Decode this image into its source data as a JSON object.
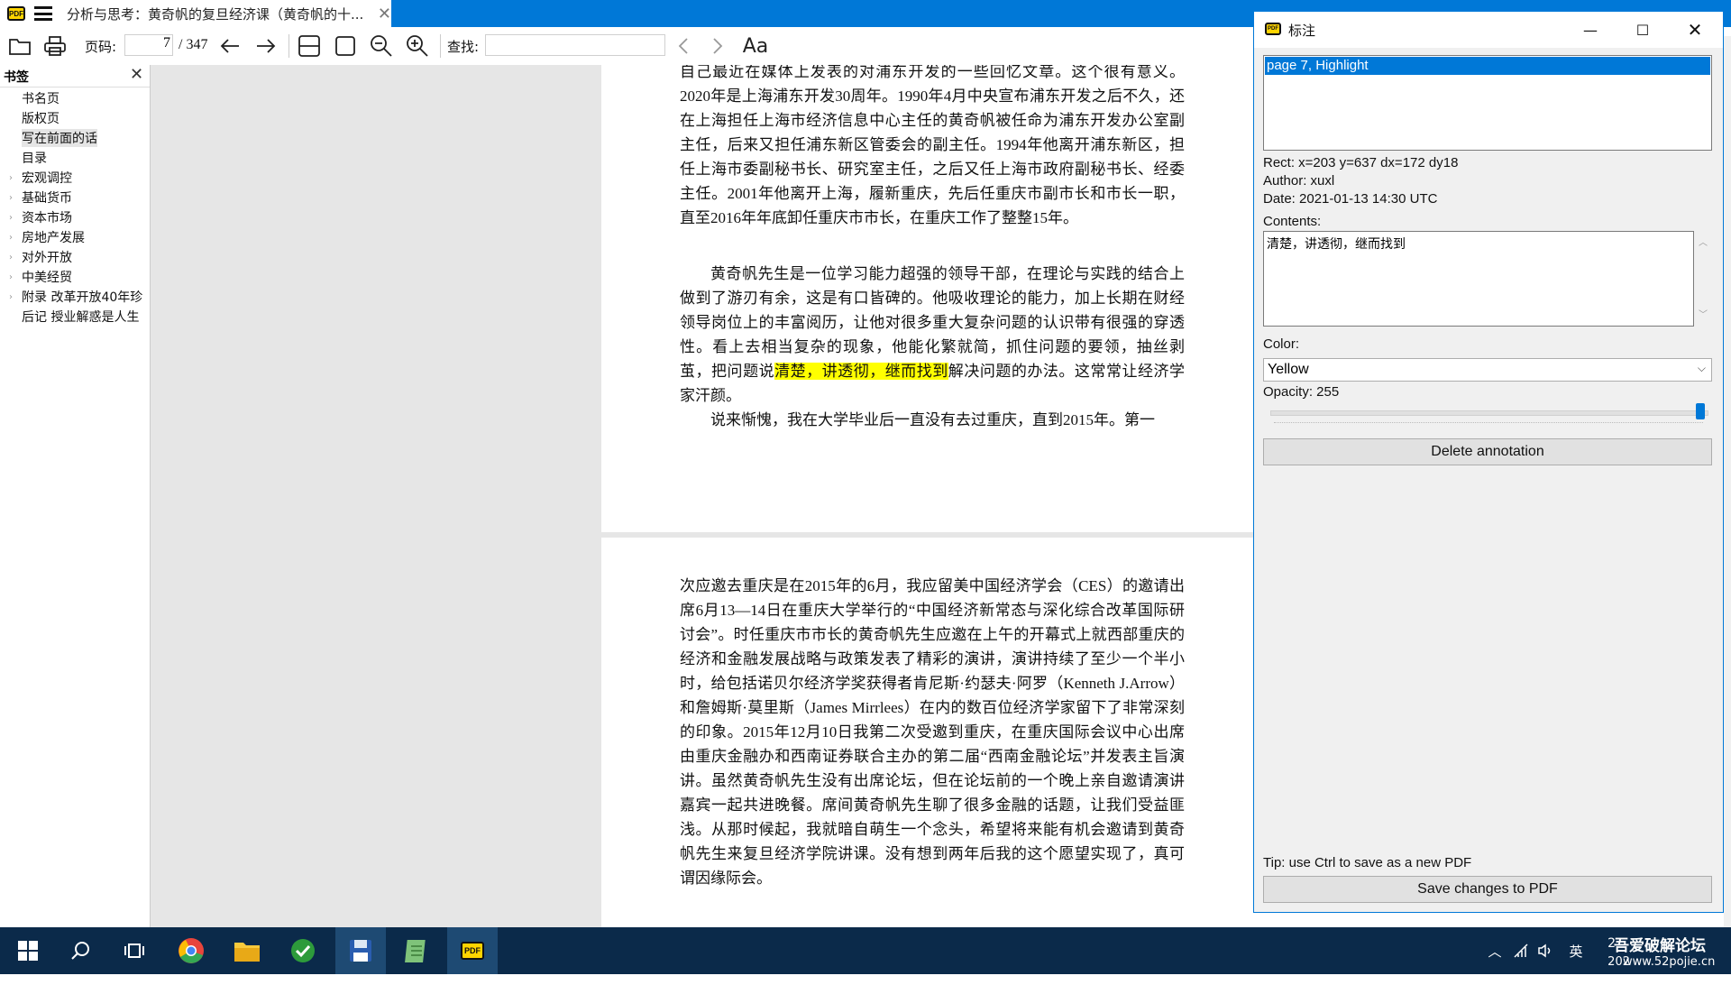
{
  "tab": {
    "title": "分析与思考：黄奇帆的复旦经济课（黄奇帆的十..."
  },
  "toolbar": {
    "page_label": "页码:",
    "page_current": "7",
    "page_total": "/ 347",
    "find_label": "查找:",
    "find_placeholder": "",
    "font_glyph": "Aa"
  },
  "sidebar": {
    "title": "书签",
    "items": [
      {
        "label": "书名页",
        "expandable": false,
        "selected": false
      },
      {
        "label": "版权页",
        "expandable": false,
        "selected": false
      },
      {
        "label": "写在前面的话",
        "expandable": false,
        "selected": true
      },
      {
        "label": "目录",
        "expandable": false,
        "selected": false
      },
      {
        "label": "宏观调控",
        "expandable": true,
        "selected": false
      },
      {
        "label": "基础货币",
        "expandable": true,
        "selected": false
      },
      {
        "label": "资本市场",
        "expandable": true,
        "selected": false
      },
      {
        "label": "房地产发展",
        "expandable": true,
        "selected": false
      },
      {
        "label": "对外开放",
        "expandable": true,
        "selected": false
      },
      {
        "label": "中美经贸",
        "expandable": true,
        "selected": false
      },
      {
        "label": "附录 改革开放40年珍",
        "expandable": true,
        "selected": false
      },
      {
        "label": "后记 授业解惑是人生",
        "expandable": false,
        "selected": false
      }
    ]
  },
  "document": {
    "page1": {
      "p1": "自己最近在媒体上发表的对浦东开发的一些回忆文章。这个很有意义。2020年是上海浦东开发30周年。1990年4月中央宣布浦东开发之后不久，还在上海担任上海市经济信息中心主任的黄奇帆被任命为浦东开发办公室副主任，后来又担任浦东新区管委会的副主任。1994年他离开浦东新区，担任上海市委副秘书长、研究室主任，之后又任上海市政府副秘书长、经委主任。2001年他离开上海，履新重庆，先后任重庆市副市长和市长一职，直至2016年年底卸任重庆市市长，在重庆工作了整整15年。",
      "p2_before": "黄奇帆先生是一位学习能力超强的领导干部，在理论与实践的结合上做到了游刃有余，这是有口皆碑的。他吸收理论的能力，加上长期在财经领导岗位上的丰富阅历，让他对很多重大复杂问题的认识带有很强的穿透性。看上去相当复杂的现象，他能化繁就简，抓住问题的要领，抽丝剥茧，把问题说",
      "p2_highlight": "清楚，讲透彻，继而找到",
      "p2_after": "解决问题的办法。这常常让经济学家汗颜。",
      "p3": "说来惭愧，我在大学毕业后一直没有去过重庆，直到2015年。第一"
    },
    "page2": {
      "p1": "次应邀去重庆是在2015年的6月，我应留美中国经济学会（CES）的邀请出席6月13—14日在重庆大学举行的“中国经济新常态与深化综合改革国际研讨会”。时任重庆市市长的黄奇帆先生应邀在上午的开幕式上就西部重庆的经济和金融发展战略与政策发表了精彩的演讲，演讲持续了至少一个半小时，给包括诺贝尔经济学奖获得者肯尼斯·约瑟夫·阿罗（Kenneth J.Arrow）和詹姆斯·莫里斯（James Mirrlees）在内的数百位经济学家留下了非常深刻的印象。2015年12月10日我第二次受邀到重庆，在重庆国际会议中心出席由重庆金融办和西南证券联合主办的第二届“西南金融论坛”并发表主旨演讲。虽然黄奇帆先生没有出席论坛，但在论坛前的一个晚上亲自邀请演讲嘉宾一起共进晚餐。席间黄奇帆先生聊了很多金融的话题，让我们受益匪浅。从那时候起，我就暗自萌生一个念头，希望将来能有机会邀请到黄奇帆先生来复旦经济学院讲课。没有想到两年后我的这个愿望实现了，真可谓因缘际会。"
    }
  },
  "dialog": {
    "title": "标注",
    "annotation_item": "page 7, Highlight",
    "rect": "Rect: x=203 y=637 dx=172 dy18",
    "author": "Author: xuxl",
    "date": "Date: 2021-01-13 14:30 UTC",
    "contents_label": "Contents:",
    "contents_value": "清楚，讲透彻，继而找到",
    "color_label": "Color:",
    "color_value": "Yellow",
    "opacity_label": "Opacity: 255",
    "opacity_fraction": 1.0,
    "delete_label": "Delete annotation",
    "tip": "Tip: use Ctrl to save as a new PDF",
    "save_label": "Save changes to PDF"
  },
  "taskbar": {
    "ime": "英",
    "watermark_line1": "吾爱破解论坛",
    "watermark_line2": "www.52pojie.cn",
    "time_partial": "2",
    "date_partial": "202"
  },
  "colors": {
    "accent": "#0078d7",
    "highlight": "#ffff00",
    "taskbar": "#0b2a4a"
  }
}
